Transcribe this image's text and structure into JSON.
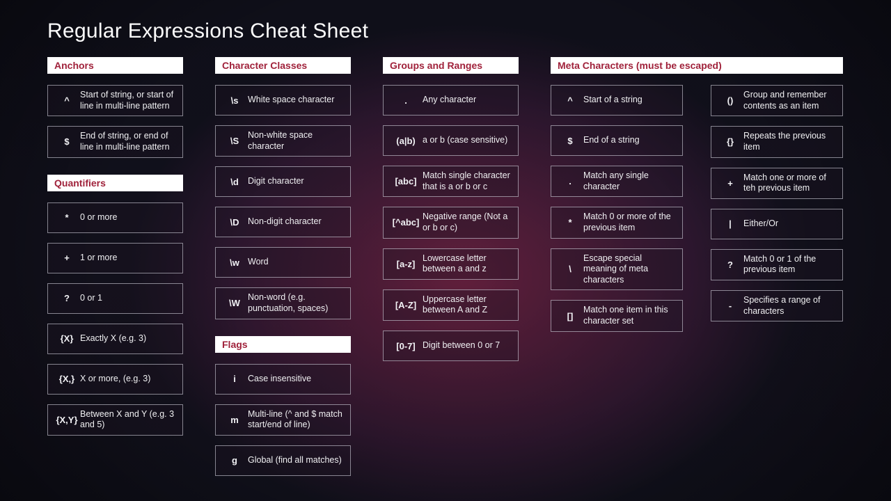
{
  "title": "Regular Expressions Cheat Sheet",
  "sections": {
    "anchors": {
      "heading": "Anchors",
      "items": [
        {
          "sym": "^",
          "desc": "Start of string, or start of line in multi-line pattern"
        },
        {
          "sym": "$",
          "desc": "End of string, or end of line in multi-line pattern"
        }
      ]
    },
    "quantifiers": {
      "heading": "Quantifiers",
      "items": [
        {
          "sym": "*",
          "desc": "0 or more"
        },
        {
          "sym": "+",
          "desc": "1 or more"
        },
        {
          "sym": "?",
          "desc": "0 or 1"
        },
        {
          "sym": "{X}",
          "desc": "Exactly X (e.g. 3)"
        },
        {
          "sym": "{X,}",
          "desc": "X or more, (e.g. 3)"
        },
        {
          "sym": "{X,Y}",
          "desc": "Between X and Y (e.g. 3 and 5)"
        }
      ]
    },
    "classes": {
      "heading": "Character Classes",
      "items": [
        {
          "sym": "\\s",
          "desc": "White space character"
        },
        {
          "sym": "\\S",
          "desc": "Non-white space character"
        },
        {
          "sym": "\\d",
          "desc": "Digit character"
        },
        {
          "sym": "\\D",
          "desc": "Non-digit character"
        },
        {
          "sym": "\\w",
          "desc": "Word"
        },
        {
          "sym": "\\W",
          "desc": "Non-word (e.g. punctuation, spaces)"
        }
      ]
    },
    "flags": {
      "heading": "Flags",
      "items": [
        {
          "sym": "i",
          "desc": "Case insensitive"
        },
        {
          "sym": "m",
          "desc": "Multi-line (^ and $ match start/end of line)"
        },
        {
          "sym": "g",
          "desc": "Global (find all matches)"
        }
      ]
    },
    "groups": {
      "heading": "Groups and Ranges",
      "items": [
        {
          "sym": ".",
          "desc": "Any character"
        },
        {
          "sym": "(a|b)",
          "desc": "a or b (case sensitive)"
        },
        {
          "sym": "[abc]",
          "desc": "Match single character that is a or b or c"
        },
        {
          "sym": "[^abc]",
          "desc": "Negative range (Not a or b or c)"
        },
        {
          "sym": "[a-z]",
          "desc": "Lowercase letter between  a and z"
        },
        {
          "sym": "[A-Z]",
          "desc": "Uppercase letter between A and Z"
        },
        {
          "sym": "[0-7]",
          "desc": "Digit between 0 or 7"
        }
      ]
    },
    "meta": {
      "heading": "Meta Characters (must be escaped)",
      "left": [
        {
          "sym": "^",
          "desc": "Start of a string"
        },
        {
          "sym": "$",
          "desc": "End of a string"
        },
        {
          "sym": ".",
          "desc": "Match any single character"
        },
        {
          "sym": "*",
          "desc": "Match 0 or more of the previous item"
        },
        {
          "sym": "\\",
          "desc": "Escape special meaning of meta characters"
        },
        {
          "sym": "[]",
          "desc": "Match one item in this character set"
        }
      ],
      "right": [
        {
          "sym": "()",
          "desc": "Group and remember contents as an item"
        },
        {
          "sym": "{}",
          "desc": "Repeats the previous item"
        },
        {
          "sym": "+",
          "desc": "Match one or more of teh previous item"
        },
        {
          "sym": "|",
          "desc": "Either/Or"
        },
        {
          "sym": "?",
          "desc": "Match 0 or 1 of the previous item"
        },
        {
          "sym": "-",
          "desc": "Specifies a range of characters"
        }
      ]
    }
  }
}
